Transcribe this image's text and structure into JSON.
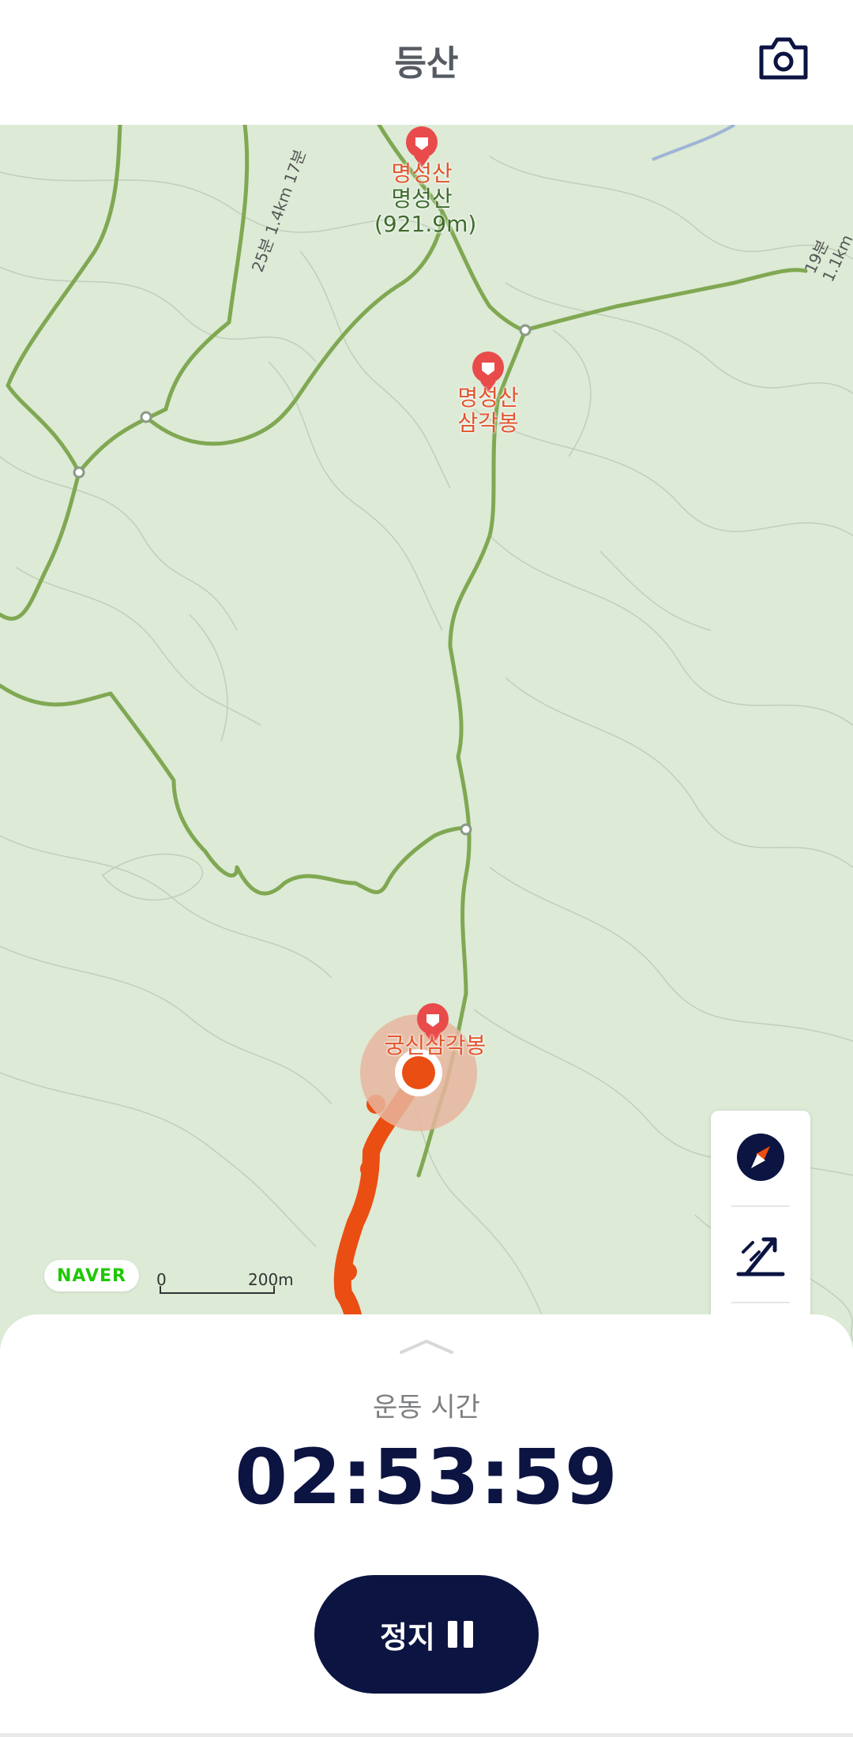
{
  "header": {
    "title": "등산",
    "camera_icon": "camera-icon"
  },
  "map": {
    "peaks": [
      {
        "name_red": "명성산",
        "name_green": "명성산",
        "elevation": "(921.9m)"
      },
      {
        "line1": "명성산",
        "line2": "삼각봉"
      },
      {
        "name": "궁신삼각봉"
      }
    ],
    "route_times": [
      "25분 1.4km 17분",
      "19분 1.1km"
    ],
    "provider": "NAVER",
    "scale": {
      "zero": "0",
      "distance": "200m"
    },
    "controls": [
      "compass-icon",
      "elevation-icon",
      "locate-icon"
    ],
    "colors": {
      "trail": "#80a852",
      "track": "#ea4e12",
      "map_bg": "#dcead6"
    }
  },
  "sheet": {
    "time_label": "운동 시간",
    "time_value": "02:53:59",
    "stop_label": "정지",
    "stop_icon": "pause-icon"
  }
}
